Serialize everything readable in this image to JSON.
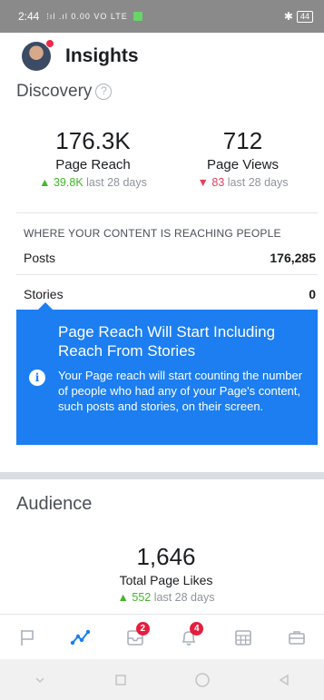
{
  "status_bar": {
    "time": "2:44",
    "signal": "⁞ıl .ıl 0.00 VO LTE",
    "battery": "44"
  },
  "header": {
    "title": "Insights"
  },
  "discovery": {
    "heading": "Discovery",
    "help_icon": "?",
    "page_reach": {
      "value": "176.3K",
      "label": "Page Reach",
      "change": "39.8K",
      "change_suffix": "last 28 days",
      "direction": "up"
    },
    "page_views": {
      "value": "712",
      "label": "Page Views",
      "change": "83",
      "change_suffix": "last 28 days",
      "direction": "down"
    },
    "reach_heading": "WHERE YOUR CONTENT IS REACHING PEOPLE",
    "rows": [
      {
        "label": "Posts",
        "value": "176,285"
      },
      {
        "label": "Stories",
        "value": "0"
      }
    ]
  },
  "tooltip": {
    "title": "Page Reach Will Start Including Reach From Stories",
    "body": "Your Page reach will start counting the number of people who had any of your Page's content, such posts and stories, on their screen.",
    "icon": "i"
  },
  "audience": {
    "heading": "Audience",
    "total_likes": {
      "value": "1,646",
      "label": "Total Page Likes",
      "change": "552",
      "change_suffix": "last 28 days",
      "direction": "up"
    }
  },
  "bottom_nav": {
    "items": [
      {
        "icon": "flag-icon",
        "badge": ""
      },
      {
        "icon": "insights-icon",
        "badge": ""
      },
      {
        "icon": "inbox-icon",
        "badge": "2"
      },
      {
        "icon": "bell-icon",
        "badge": "4"
      },
      {
        "icon": "calendar-icon",
        "badge": ""
      },
      {
        "icon": "briefcase-icon",
        "badge": ""
      }
    ]
  },
  "colors": {
    "accent": "#1c7ef0",
    "up": "#42b72a",
    "down": "#e4405f",
    "badge": "#e41e3f"
  }
}
